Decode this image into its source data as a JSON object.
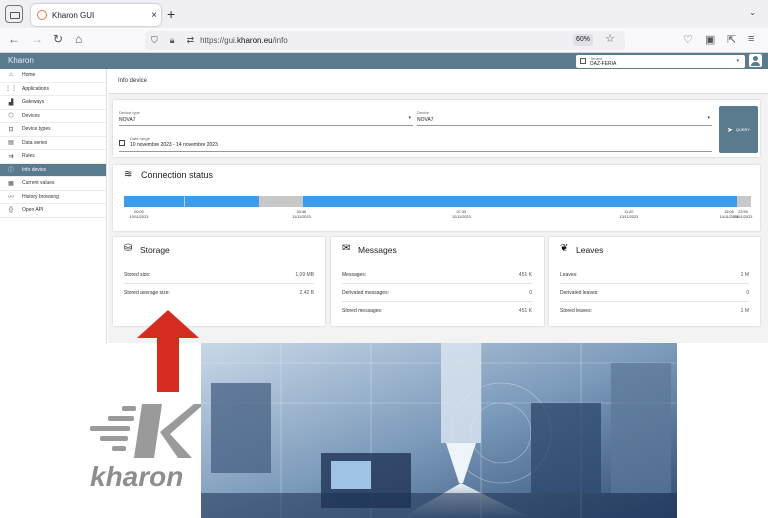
{
  "browser": {
    "tab_title": "Kharon GUI",
    "tab_close": "×",
    "new_tab": "+",
    "url_prefix": "https://gui.",
    "url_domain": "kharon.eu",
    "url_path": "/info",
    "zoom": "60%"
  },
  "app": {
    "title": "Kharon",
    "tenant_label": "Tenant",
    "tenant_value": "DAZ-FERIA"
  },
  "sidebar": {
    "items": [
      {
        "label": "Home",
        "icon": "home-icon",
        "glyph": "⌂"
      },
      {
        "label": "Applications",
        "icon": "apps-icon",
        "glyph": "⋮⋮"
      },
      {
        "label": "Gateways",
        "icon": "gateway-icon",
        "glyph": "▟"
      },
      {
        "label": "Devices",
        "icon": "device-icon",
        "glyph": "⬡"
      },
      {
        "label": "Device types",
        "icon": "device-types-icon",
        "glyph": "⊡"
      },
      {
        "label": "Data series",
        "icon": "data-series-icon",
        "glyph": "▤"
      },
      {
        "label": "Rules",
        "icon": "rules-icon",
        "glyph": "⇉"
      },
      {
        "label": "Info device",
        "icon": "info-icon",
        "glyph": "ⓘ",
        "active": true
      },
      {
        "label": "Current values",
        "icon": "current-values-icon",
        "glyph": "▦"
      },
      {
        "label": "History browsing",
        "icon": "history-icon",
        "glyph": "〰"
      },
      {
        "label": "Open API",
        "icon": "api-icon",
        "glyph": "{}"
      }
    ]
  },
  "page": {
    "heading": "Info device"
  },
  "query": {
    "device_type_label": "Device type",
    "device_type_value": "NOVA7",
    "device_label": "Device",
    "device_value": "NOVA7",
    "date_range_label": "Date range",
    "date_range_value": "10 novembre 2023 - 14 novembre 2023",
    "button_label": "QUERY"
  },
  "connection": {
    "title": "Connection status",
    "online_color": "#3d9be9",
    "offline_color": "#c8c8c8",
    "segments": [
      {
        "from": 0.0,
        "to": 0.095,
        "state": "online"
      },
      {
        "from": 0.095,
        "to": 0.097,
        "state": "offline"
      },
      {
        "from": 0.097,
        "to": 0.215,
        "state": "online"
      },
      {
        "from": 0.215,
        "to": 0.285,
        "state": "offline"
      },
      {
        "from": 0.285,
        "to": 0.293,
        "state": "online"
      },
      {
        "from": 0.293,
        "to": 0.977,
        "state": "online"
      },
      {
        "from": 0.977,
        "to": 1.0,
        "state": "offline"
      }
    ],
    "ticks": [
      {
        "pos": 0.0,
        "time": "00:00",
        "date": "10/11/2023"
      },
      {
        "pos": 0.283,
        "time": "03:46",
        "date": "11/11/2023"
      },
      {
        "pos": 0.538,
        "time": "07:33",
        "date": "12/11/2023"
      },
      {
        "pos": 0.805,
        "time": "11:20",
        "date": "13/11/2023"
      },
      {
        "pos": 0.965,
        "time": "15:06",
        "date": "14/11/2023"
      },
      {
        "pos": 1.0,
        "time": "23:59",
        "date": "14/11/2023"
      }
    ]
  },
  "storage": {
    "title": "Storage",
    "rows": [
      {
        "label": "Stored size:",
        "value": "1.09 MB"
      },
      {
        "label": "Stored average size:",
        "value": "2.42 B"
      }
    ]
  },
  "messages": {
    "title": "Messages",
    "rows": [
      {
        "label": "Messages:",
        "value": "451 K"
      },
      {
        "label": "Derivated messages:",
        "value": "0"
      },
      {
        "label": "Stored messages:",
        "value": "451 K"
      }
    ]
  },
  "leaves": {
    "title": "Leaves",
    "rows": [
      {
        "label": "Leaves:",
        "value": "1 M"
      },
      {
        "label": "Derivated leaves:",
        "value": "0"
      },
      {
        "label": "Stored leaves:",
        "value": "1 M"
      }
    ]
  },
  "branding": {
    "logo_text": "kharon",
    "arrow_color": "#d42c1f"
  }
}
